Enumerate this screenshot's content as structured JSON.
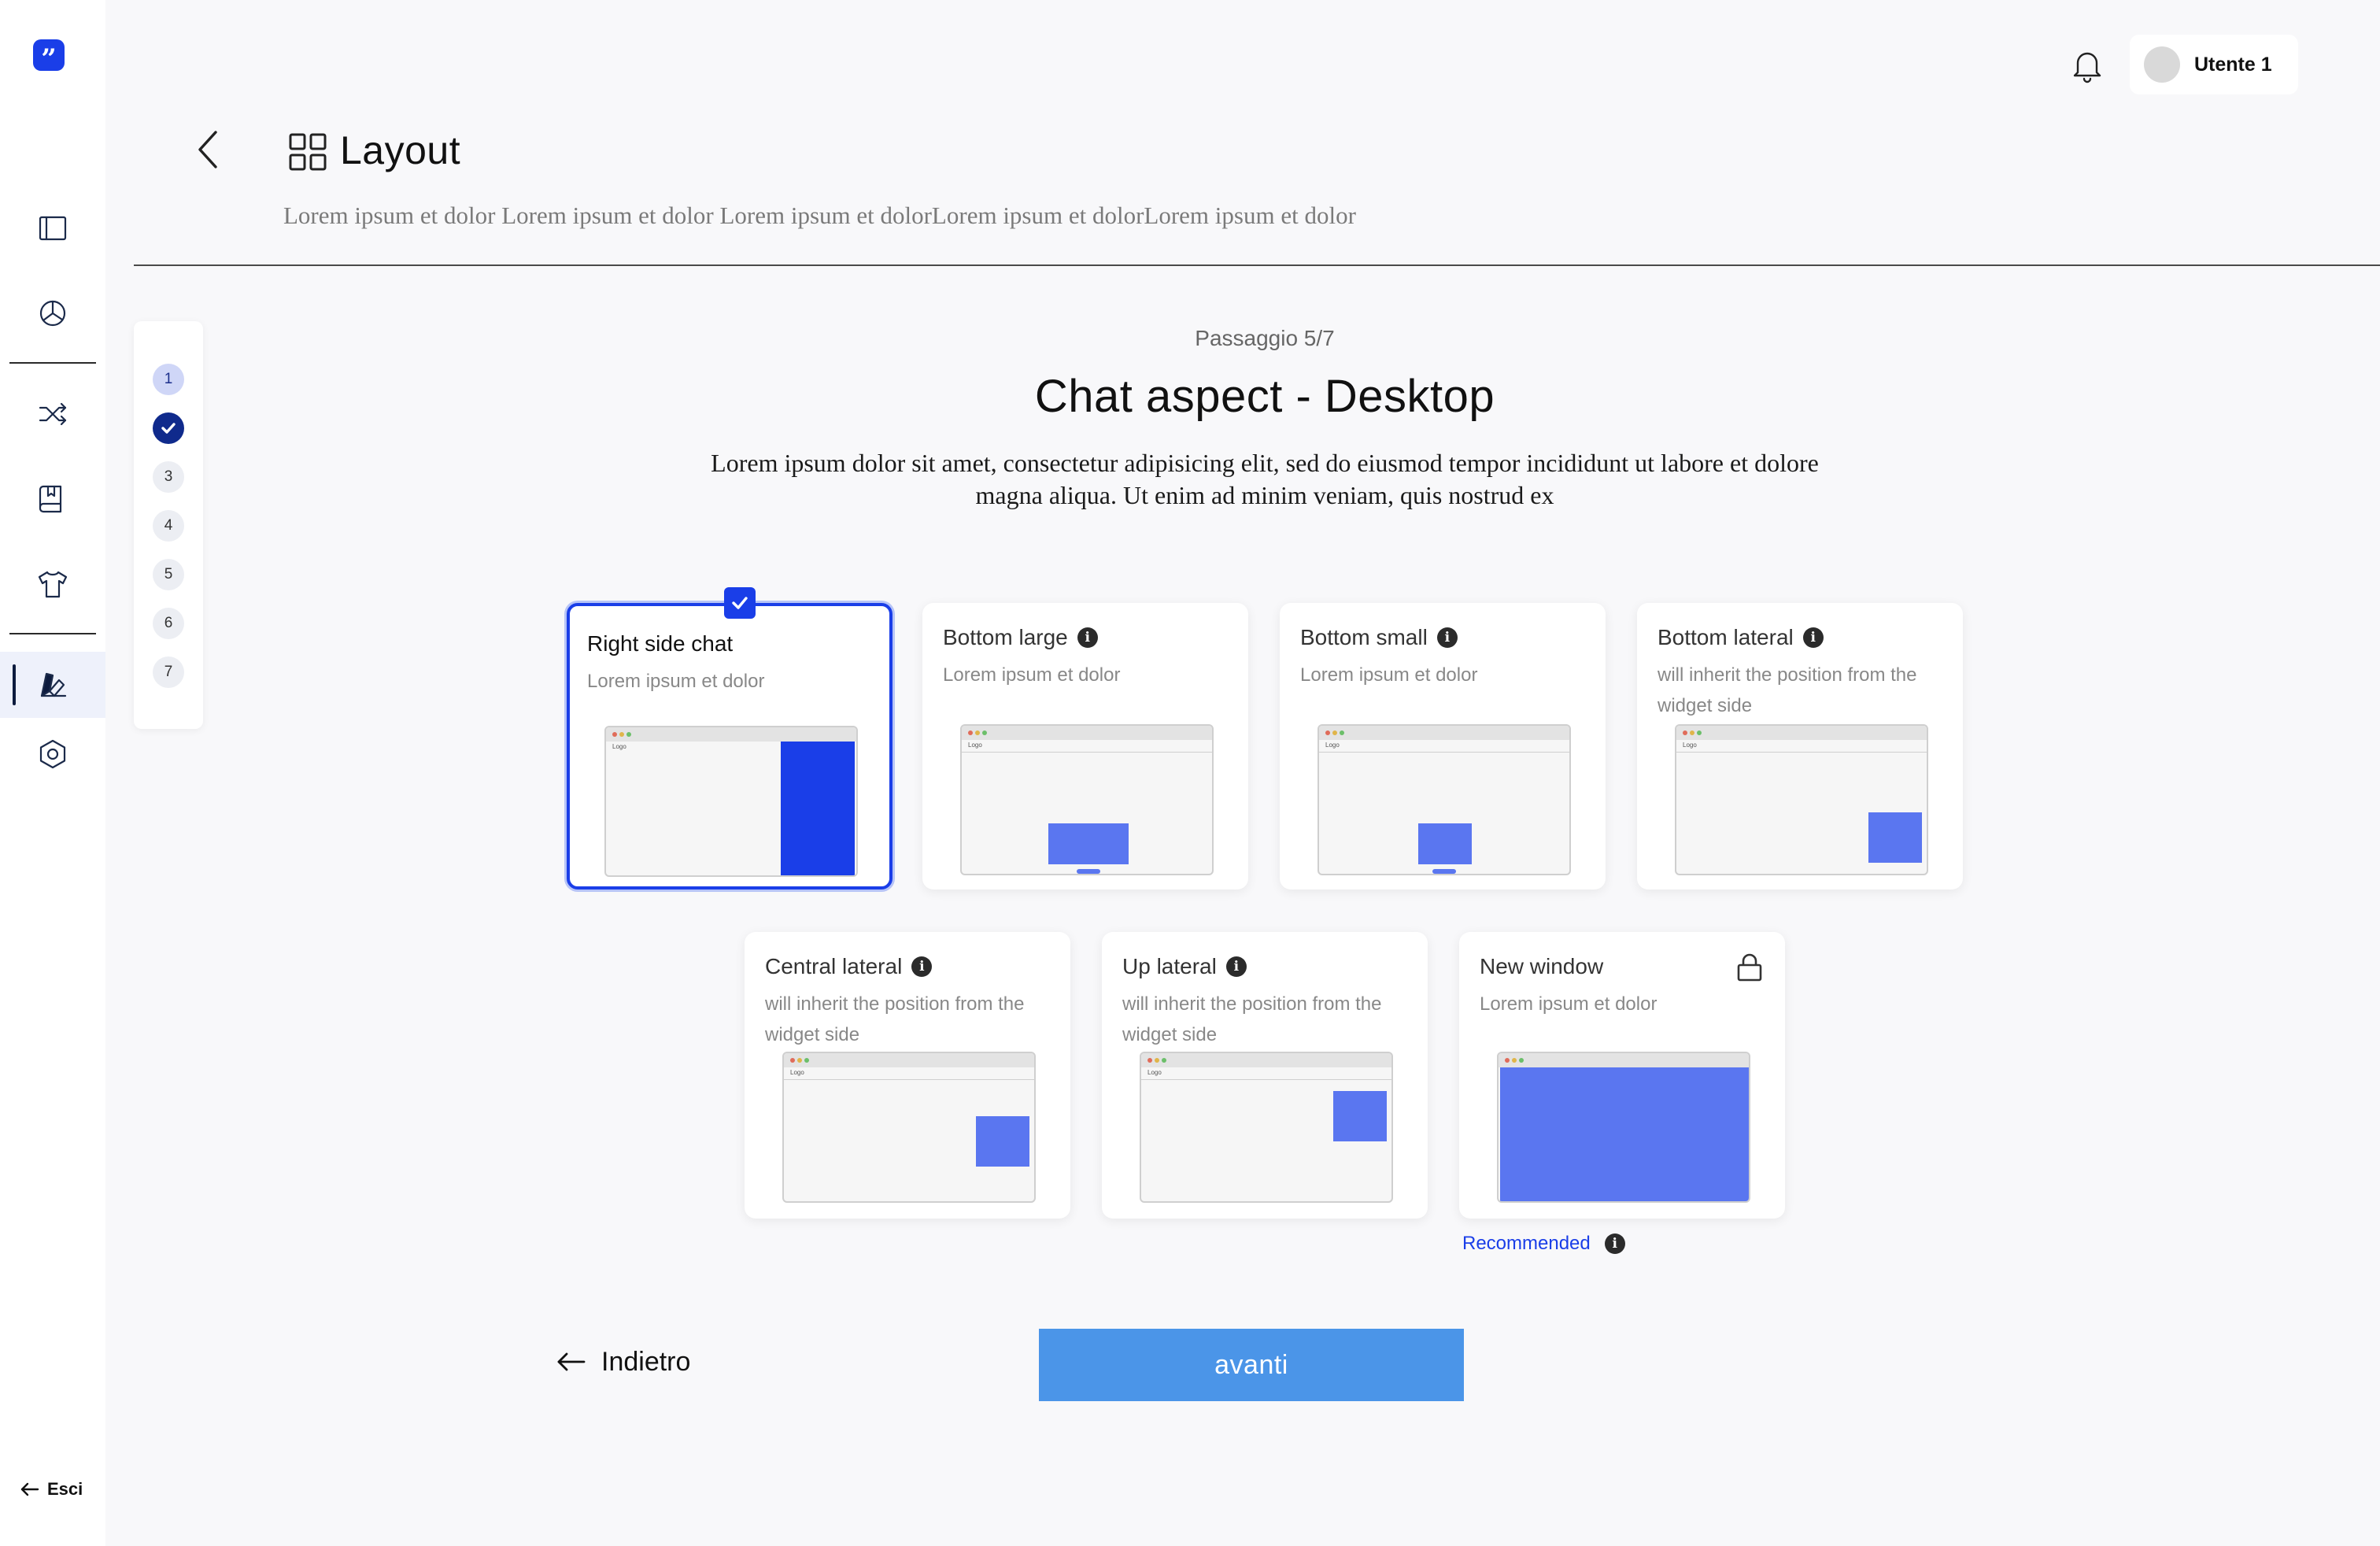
{
  "app": {
    "logo_label": "”"
  },
  "sidebar": {
    "items": [
      {
        "name": "sidebar-item-panel",
        "icon": "panel-icon"
      },
      {
        "name": "sidebar-item-analytics",
        "icon": "pie-chart-icon"
      },
      {
        "name": "sidebar-item-shuffle",
        "icon": "shuffle-icon"
      },
      {
        "name": "sidebar-item-library",
        "icon": "book-icon"
      },
      {
        "name": "sidebar-item-apparel",
        "icon": "shirt-icon"
      },
      {
        "name": "sidebar-item-design",
        "icon": "swatch-icon",
        "active": true
      },
      {
        "name": "sidebar-item-settings",
        "icon": "hexagon-gear-icon"
      }
    ],
    "exit_label": "Esci"
  },
  "topbar": {
    "user_name": "Utente 1"
  },
  "header": {
    "title": "Layout",
    "subtitle": "Lorem ipsum et dolor Lorem ipsum et dolor Lorem ipsum et dolorLorem ipsum et dolorLorem ipsum et dolor"
  },
  "stepper": {
    "steps": [
      {
        "label": "1",
        "state": "current"
      },
      {
        "label": "",
        "state": "done"
      },
      {
        "label": "3",
        "state": "todo"
      },
      {
        "label": "4",
        "state": "todo"
      },
      {
        "label": "5",
        "state": "todo"
      },
      {
        "label": "6",
        "state": "todo"
      },
      {
        "label": "7",
        "state": "todo"
      }
    ]
  },
  "content": {
    "step_counter": "Passaggio 5/7",
    "title": "Chat aspect - Desktop",
    "description": "Lorem ipsum dolor sit amet, consectetur adipisicing elit, sed do eiusmod tempor incididunt ut labore et dolore magna aliqua. Ut enim ad minim veniam, quis nostrud ex"
  },
  "options": [
    {
      "title": "Right side chat",
      "desc": "Lorem ipsum et dolor",
      "selected": true
    },
    {
      "title": "Bottom large",
      "desc": "Lorem ipsum et dolor"
    },
    {
      "title": "Bottom small",
      "desc": "Lorem ipsum et dolor"
    },
    {
      "title": "Bottom lateral",
      "desc": "will inherit the position from the widget side"
    },
    {
      "title": "Central lateral",
      "desc": "will inherit the position from the widget side"
    },
    {
      "title": "Up lateral",
      "desc": "will inherit the position from the widget side"
    },
    {
      "title": "New window",
      "desc": "Lorem ipsum et dolor",
      "locked": true
    }
  ],
  "mock": {
    "logo_text": "Logo"
  },
  "recommended_label": "Recommended",
  "footer": {
    "back_label": "Indietro",
    "next_label": "avanti"
  },
  "colors": {
    "accent": "#1a3ee8",
    "widget": "#5a76f0",
    "primary_button": "#4b95e8",
    "step_done": "#0f2a8c"
  }
}
